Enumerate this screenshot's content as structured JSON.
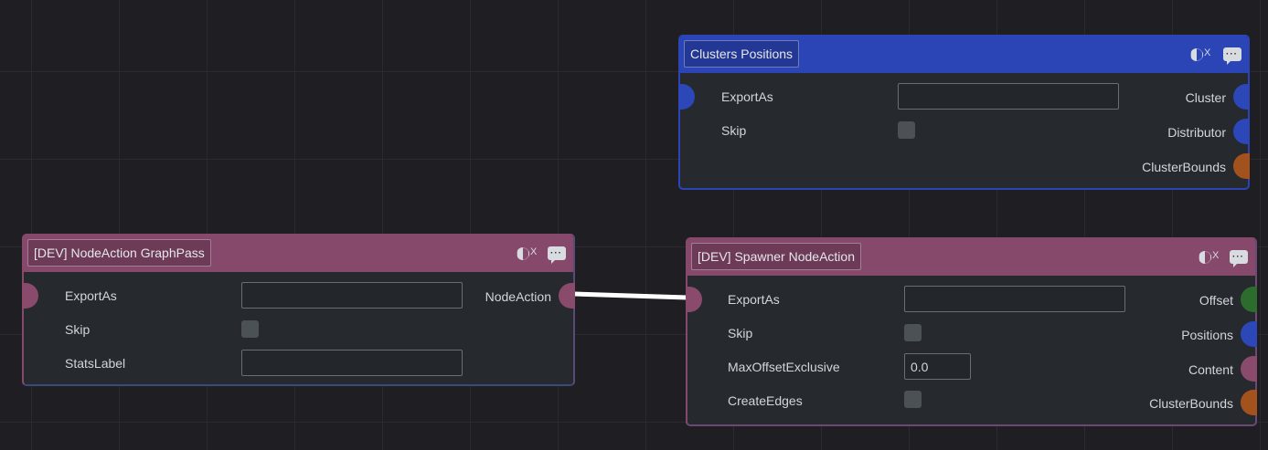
{
  "colors": {
    "canvas": "#1e1e23",
    "node_body": "#26292d",
    "pink_header": "#86496c",
    "blue_header": "#2b45b6",
    "pin_blue": "#2b47b8",
    "pin_pink": "#8a4a6c",
    "pin_orange": "#a4521d",
    "pin_green": "#2c6d2d",
    "wire": "#ffffff"
  },
  "nodes": {
    "clusters_positions": {
      "title": "Clusters Positions",
      "header_icons": [
        "half-circle-toggle-icon",
        "comment-bubble-icon"
      ],
      "toggle_glyph": "X",
      "inputs": {
        "export_as": {
          "label": "ExportAs",
          "value": ""
        },
        "skip": {
          "label": "Skip",
          "checked": false
        }
      },
      "outputs": [
        "Cluster",
        "Distributor",
        "ClusterBounds"
      ]
    },
    "graph_pass": {
      "title": "[DEV] NodeAction GraphPass",
      "toggle_glyph": "X",
      "inputs": {
        "export_as": {
          "label": "ExportAs",
          "value": ""
        },
        "skip": {
          "label": "Skip",
          "checked": false
        },
        "stats_label": {
          "label": "StatsLabel",
          "value": ""
        }
      },
      "outputs": [
        "NodeAction"
      ]
    },
    "spawner": {
      "title": "[DEV] Spawner NodeAction",
      "toggle_glyph": "X",
      "inputs": {
        "export_as": {
          "label": "ExportAs",
          "value": ""
        },
        "skip": {
          "label": "Skip",
          "checked": false
        },
        "max_offset": {
          "label": "MaxOffsetExclusive",
          "value": "0.0"
        },
        "create_edges": {
          "label": "CreateEdges",
          "checked": false
        }
      },
      "outputs": [
        "Offset",
        "Positions",
        "Content",
        "ClusterBounds"
      ]
    }
  }
}
